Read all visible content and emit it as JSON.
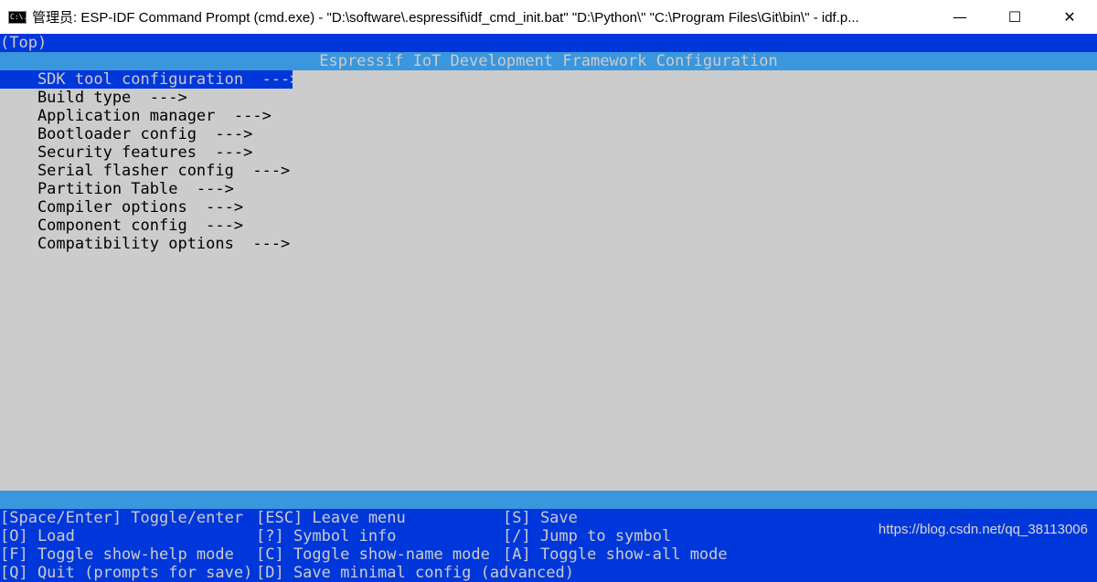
{
  "window": {
    "title": "管理员: ESP-IDF Command Prompt (cmd.exe) - \"D:\\software\\.espressif\\idf_cmd_init.bat\"  \"D:\\Python\\\" \"C:\\Program Files\\Git\\bin\\\" - idf.p...",
    "icon_text": "C:\\.",
    "minimize": "—",
    "maximize": "☐",
    "close": "✕"
  },
  "terminal": {
    "path": "(Top)",
    "header": "Espressif IoT Development Framework Configuration",
    "menu_items": [
      {
        "label": "    SDK tool configuration  --->",
        "selected": true
      },
      {
        "label": "    Build type  --->",
        "selected": false
      },
      {
        "label": "    Application manager  --->",
        "selected": false
      },
      {
        "label": "    Bootloader config  --->",
        "selected": false
      },
      {
        "label": "    Security features  --->",
        "selected": false
      },
      {
        "label": "    Serial flasher config  --->",
        "selected": false
      },
      {
        "label": "    Partition Table  --->",
        "selected": false
      },
      {
        "label": "    Compiler options  --->",
        "selected": false
      },
      {
        "label": "    Component config  --->",
        "selected": false
      },
      {
        "label": "    Compatibility options  --->",
        "selected": false
      }
    ],
    "help": [
      [
        "[Space/Enter] Toggle/enter",
        "[ESC] Leave menu",
        "[S] Save"
      ],
      [
        "[O] Load",
        "[?] Symbol info",
        "[/] Jump to symbol"
      ],
      [
        "[F] Toggle show-help mode",
        "[C] Toggle show-name mode",
        "[A] Toggle show-all mode"
      ],
      [
        "[Q] Quit (prompts for save)",
        "[D] Save minimal config (advanced)",
        ""
      ]
    ]
  },
  "watermark": "https://blog.csdn.net/qq_38113006",
  "colors": {
    "terminal_bg": "#cccccc",
    "selection_blue": "#0037da",
    "header_blue": "#3a96dd",
    "light_text": "#cccccc"
  }
}
